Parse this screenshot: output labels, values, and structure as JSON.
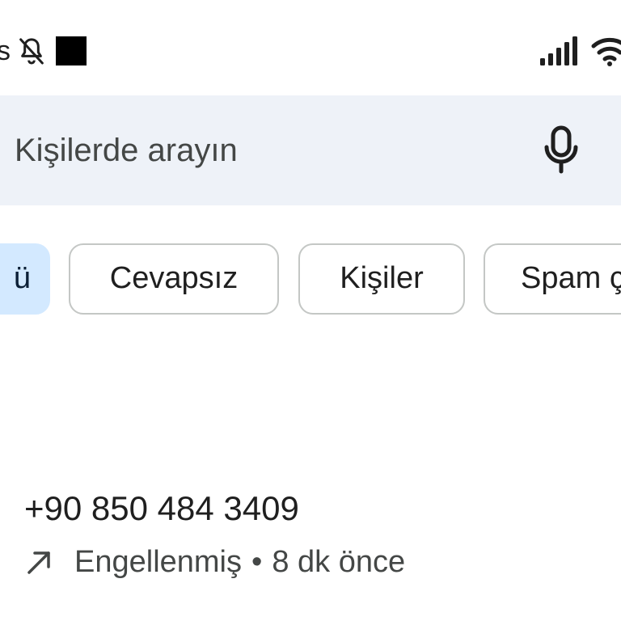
{
  "status_bar": {
    "left_text": "s",
    "icons": [
      "bell-off-icon",
      "black-square",
      "signal-icon",
      "wifi-icon"
    ]
  },
  "search": {
    "placeholder": "Kişilerde arayın",
    "icon": "mic-icon"
  },
  "filters": {
    "chips": [
      {
        "label": "ü",
        "selected": true
      },
      {
        "label": "Cevapsız",
        "selected": false
      },
      {
        "label": "Kişiler",
        "selected": false
      },
      {
        "label": "Spam ç",
        "selected": false
      }
    ]
  },
  "call_log": {
    "entries": [
      {
        "number": "+90 850 484 3409",
        "direction_icon": "outgoing-arrow-icon",
        "status": "Engellenmiş",
        "separator": "•",
        "time": "8 dk önce"
      }
    ]
  },
  "colors": {
    "search_bg": "#eef2f8",
    "chip_selected_bg": "#d3e9ff",
    "chip_border": "#c4c7c5",
    "text_primary": "#1f1f1f",
    "text_secondary": "#444746"
  }
}
